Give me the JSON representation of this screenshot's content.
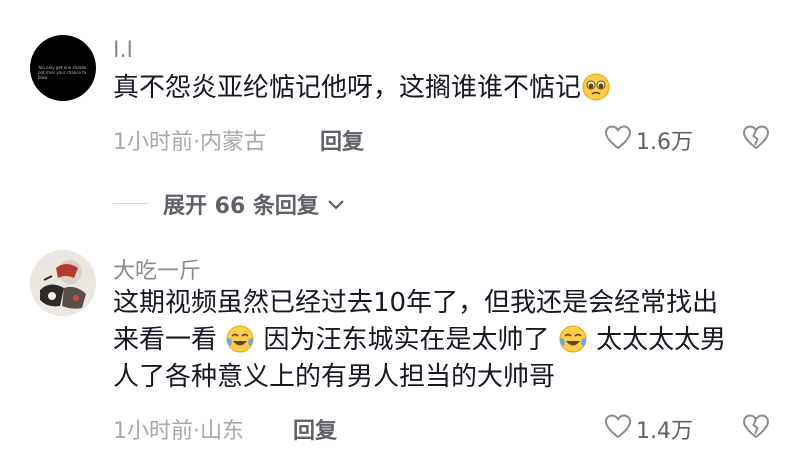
{
  "comments": [
    {
      "username": "I.I",
      "avatar_text": "You only get one shotdo not miss your chance to blow",
      "text_parts": [
        "真不怨炎亚纶惦记他呀，这搁谁谁不惦记"
      ],
      "emoji_after": "pleading-face-emoji",
      "meta": "1小时前·内蒙古",
      "reply_label": "回复",
      "likes": "1.6万"
    },
    {
      "username": "大吃一斤",
      "text_parts": [
        "这期视频虽然已经过去10年了，但我还是会经常找出",
        "来看一看",
        "因为汪东城实在是太帅了",
        "太太太太男",
        "人了各种意义上的有男人担当的大帅哥"
      ],
      "meta": "1小时前·山东",
      "reply_label": "回复",
      "likes": "1.4万"
    }
  ],
  "expand_replies": "展开 66 条回复",
  "icons": {
    "like": "heart-outline-icon",
    "dislike": "broken-heart-icon",
    "expand": "chevron-down-icon",
    "emoji": "crying-laughing-emoji"
  },
  "colors": {
    "primary_text": "#161823",
    "secondary_text": "#a7a8ad",
    "action_text": "#5f6068"
  }
}
